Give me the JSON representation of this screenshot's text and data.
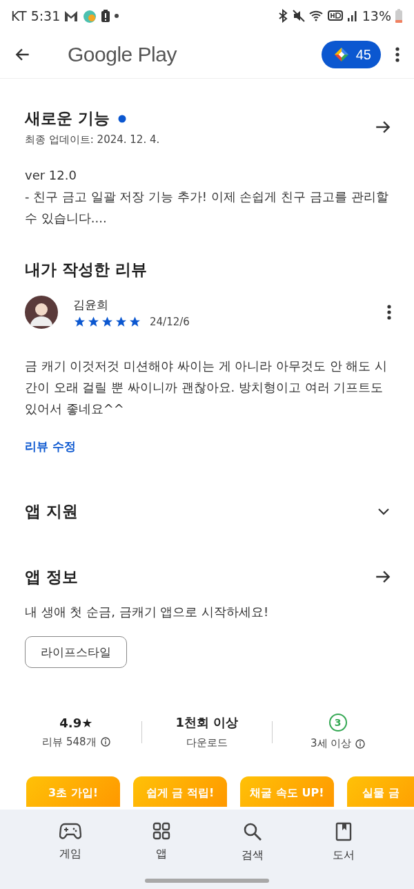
{
  "status_bar": {
    "carrier": "KT",
    "time": "5:31",
    "battery": "13%"
  },
  "header": {
    "title": "Google Play",
    "points": "45"
  },
  "whats_new": {
    "title": "새로운 기능",
    "has_new": true,
    "updated": "최종 업데이트: 2024. 12. 4.",
    "version": "ver 12.0",
    "notes": "- 친구 금고 일괄 저장 기능 추가! 이제 손쉽게 친구 금고를 관리할 수 있습니다...."
  },
  "my_review": {
    "title": "내가 작성한 리뷰",
    "author": "김윤희",
    "stars": 5,
    "date": "24/12/6",
    "text": "금 캐기 이것저것 미션해야 싸이는 게 아니라 아무것도 안 해도 시간이 오래 걸릴 뿐 싸이니까 괜찮아요. 방치형이고 여러 기프트도 있어서 좋네요^^",
    "edit_link": "리뷰 수정"
  },
  "app_support": {
    "title": "앱 지원",
    "expanded": false
  },
  "app_info": {
    "title": "앱 정보",
    "description": "내 생애 첫 순금, 금캐기 앱으로 시작하세요!",
    "category": "라이프스타일"
  },
  "stats": [
    {
      "kind": "rating",
      "value": "4.9★",
      "label": "리뷰 548개",
      "info": true
    },
    {
      "kind": "plain",
      "value": "1천회 이상",
      "label": "다운로드",
      "info": false
    },
    {
      "kind": "age",
      "value": "3",
      "label": "3세 이상",
      "info": true
    }
  ],
  "screenshots": [
    {
      "title": "3초 가입!"
    },
    {
      "title": "쉽게 금 적립!"
    },
    {
      "title": "채굴 속도 UP!"
    },
    {
      "title": "실물 금"
    }
  ],
  "bottom_nav": [
    {
      "label": "게임",
      "kind": "games"
    },
    {
      "label": "앱",
      "kind": "apps"
    },
    {
      "label": "검색",
      "kind": "search"
    },
    {
      "label": "도서",
      "kind": "books"
    }
  ]
}
